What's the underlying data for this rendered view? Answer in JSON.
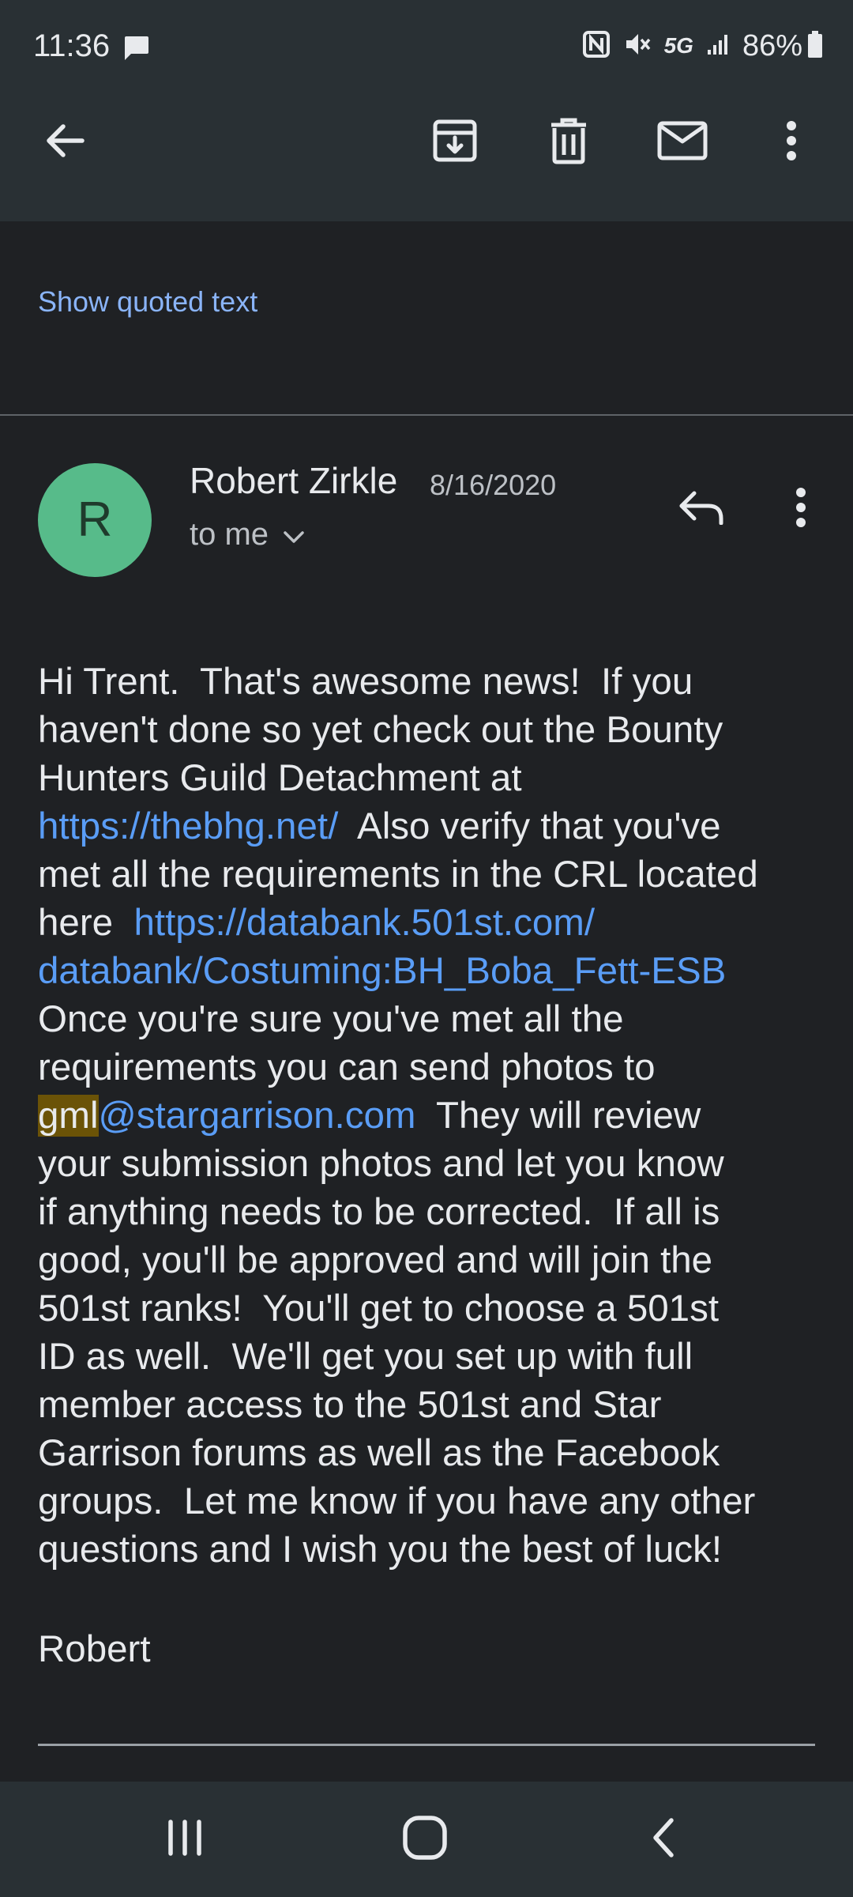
{
  "status_bar": {
    "time": "11:36",
    "network": "5G",
    "battery": "86%"
  },
  "toolbar": {
    "icons": [
      "back-arrow-icon",
      "archive-icon",
      "delete-icon",
      "mark-unread-icon",
      "more-vert-icon"
    ]
  },
  "thread": {
    "show_quoted_text": "Show quoted text"
  },
  "message": {
    "avatar_letter": "R",
    "avatar_color": "#57bb8a",
    "sender": "Robert Zirkle",
    "date": "8/16/2020",
    "recipient": "to me",
    "body_lines": [
      "Hi Trent.  That's awesome news!  If you",
      "haven't done so yet check out the Bounty",
      "Hunters Guild Detachment at",
      {
        "link": "https://thebhg.net/",
        "after": "  Also verify that you've"
      },
      "met all the requirements in the CRL located",
      {
        "before": "here  ",
        "link": "https://databank.501st.com/"
      },
      {
        "link": "databank/Costuming:BH_Boba_Fett-ESB"
      },
      "Once you're sure you've met all the",
      "requirements you can send photos to",
      {
        "highlight": "gml",
        "link": "@stargarrison.com",
        "after": "  They will review"
      },
      "your submission photos and let you know",
      "if anything needs to be corrected.  If all is",
      "good, you'll be approved and will join the",
      "501st ranks!  You'll get to choose a 501st",
      "ID as well.  We'll get you set up with full",
      "member access to the 501st and Star",
      "Garrison forums as well as the Facebook",
      "groups.  Let me know if you have any other",
      "questions and I wish you the best of luck!"
    ],
    "signature": "Robert"
  },
  "colors": {
    "background": "#1f2124",
    "bars": "#293034",
    "link": "#5a9df6",
    "highlight": "#6b5307"
  }
}
